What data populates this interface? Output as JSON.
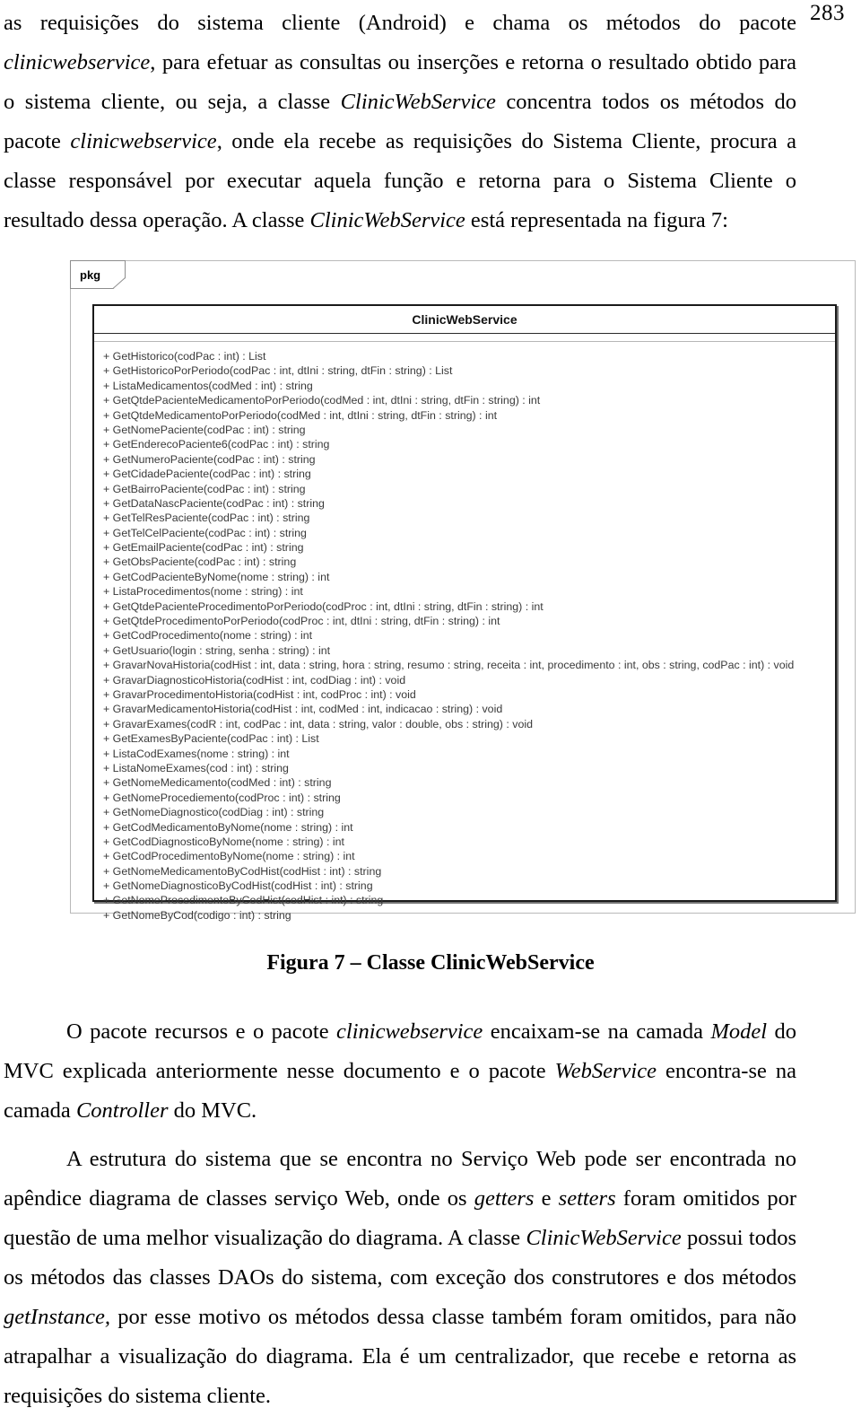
{
  "page": {
    "number": "283"
  },
  "paragraphs": {
    "top": {
      "segments": [
        {
          "t": "as requisições do sistema cliente (Android) e chama os métodos do pacote ",
          "style": "normal"
        },
        {
          "t": "clinicwebservice",
          "style": "italic"
        },
        {
          "t": ", para efetuar as consultas ou inserções e retorna o resultado obtido para o sistema cliente, ou seja, a classe ",
          "style": "normal"
        },
        {
          "t": "ClinicWebService",
          "style": "italic"
        },
        {
          "t": " concentra todos os métodos do pacote ",
          "style": "normal"
        },
        {
          "t": "clinicwebservice",
          "style": "italic"
        },
        {
          "t": ", onde ela recebe as requisições do Sistema Cliente, procura a classe responsável por executar aquela função e retorna para o Sistema Cliente o resultado dessa operação. A classe ",
          "style": "normal"
        },
        {
          "t": "ClinicWebService",
          "style": "italic"
        },
        {
          "t": " está representada na figura 7:",
          "style": "normal"
        }
      ]
    },
    "after_figure": {
      "segments": [
        {
          "t": "O pacote recursos e o pacote ",
          "style": "normal"
        },
        {
          "t": "clinicwebservice",
          "style": "italic"
        },
        {
          "t": " encaixam-se na camada ",
          "style": "normal"
        },
        {
          "t": "Model",
          "style": "italic"
        },
        {
          "t": " do MVC explicada anteriormente nesse documento e o pacote ",
          "style": "normal"
        },
        {
          "t": "WebService",
          "style": "italic"
        },
        {
          "t": " encontra-se na camada ",
          "style": "normal"
        },
        {
          "t": "Controller",
          "style": "italic"
        },
        {
          "t": " do MVC.",
          "style": "normal"
        }
      ]
    },
    "last": {
      "segments": [
        {
          "t": "A estrutura do sistema que se encontra no Serviço Web pode ser encontrada no apêndice diagrama de classes serviço Web, onde os ",
          "style": "normal"
        },
        {
          "t": "getters",
          "style": "italic"
        },
        {
          "t": " e ",
          "style": "normal"
        },
        {
          "t": "setters",
          "style": "italic"
        },
        {
          "t": " foram omitidos por questão de uma melhor visualização do diagrama. A classe ",
          "style": "normal"
        },
        {
          "t": "ClinicWebService",
          "style": "italic"
        },
        {
          "t": " possui todos os métodos das classes DAOs do sistema, com exceção dos construtores e dos métodos ",
          "style": "normal"
        },
        {
          "t": "getInstance,",
          "style": "italic"
        },
        {
          "t": " por esse motivo os métodos dessa classe também foram omitidos, para não atrapalhar a visualização do diagrama. Ela é um centralizador, que recebe e retorna as requisições do sistema cliente.",
          "style": "normal"
        }
      ]
    }
  },
  "figure": {
    "package_label": "pkg",
    "class_name": "ClinicWebService",
    "caption": "Figura 7 – Classe ClinicWebService",
    "operations": [
      "+ GetHistorico(codPac : int) : List",
      "+ GetHistoricoPorPeriodo(codPac : int, dtIni : string, dtFin : string) : List",
      "+ ListaMedicamentos(codMed : int) : string",
      "+ GetQtdePacienteMedicamentoPorPeriodo(codMed : int, dtIni : string, dtFin : string) : int",
      "+ GetQtdeMedicamentoPorPeriodo(codMed : int, dtIni : string, dtFin : string) : int",
      "+ GetNomePaciente(codPac : int) : string",
      "+ GetEnderecoPaciente6(codPac : int) : string",
      "+ GetNumeroPaciente(codPac : int) : string",
      "+ GetCidadePaciente(codPac : int) : string",
      "+ GetBairroPaciente(codPac : int) : string",
      "+ GetDataNascPaciente(codPac : int) : string",
      "+ GetTelResPaciente(codPac : int) : string",
      "+ GetTelCelPaciente(codPac : int) : string",
      "+ GetEmailPaciente(codPac : int) : string",
      "+ GetObsPaciente(codPac : int) : string",
      "+ GetCodPacienteByNome(nome : string) : int",
      "+ ListaProcedimentos(nome : string) : int",
      "+ GetQtdePacienteProcedimentoPorPeriodo(codProc : int, dtIni : string, dtFin : string) : int",
      "+ GetQtdeProcedimentoPorPeriodo(codProc : int, dtIni : string, dtFin : string) : int",
      "+ GetCodProcedimento(nome : string) : int",
      "+ GetUsuario(login : string, senha : string) : int",
      "+ GravarNovaHistoria(codHist : int, data : string, hora : string, resumo : string, receita : int, procedimento : int, obs : string, codPac : int) : void",
      "+ GravarDiagnosticoHistoria(codHist : int, codDiag : int) : void",
      "+ GravarProcedimentoHistoria(codHist : int, codProc : int) : void",
      "+ GravarMedicamentoHistoria(codHist : int, codMed : int, indicacao : string) : void",
      "+ GravarExames(codR : int, codPac : int, data : string, valor : double, obs : string) : void",
      "+ GetExamesByPaciente(codPac : int) : List",
      "+ ListaCodExames(nome : string) : int",
      "+ ListaNomeExames(cod : int) : string",
      "+ GetNomeMedicamento(codMed : int) : string",
      "+ GetNomeProcediemento(codProc : int) : string",
      "+ GetNomeDiagnostico(codDiag : int) : string",
      "+ GetCodMedicamentoByNome(nome : string) : int",
      "+ GetCodDiagnosticoByNome(nome : string) : int",
      "+ GetCodProcedimentoByNome(nome : string) : int",
      "+ GetNomeMedicamentoByCodHist(codHist : int) : string",
      "+ GetNomeDiagnosticoByCodHist(codHist : int) : string",
      "+ GetNomeProcedimentoByCodHist(codHist : int) : string",
      "+ GetNomeByCod(codigo : int) : string"
    ]
  },
  "colors": {
    "text": "#000000",
    "uml_border": "#1a1a1a",
    "uml_frame": "#b9b9b9",
    "uml_ops_text": "#3a3a3a"
  }
}
